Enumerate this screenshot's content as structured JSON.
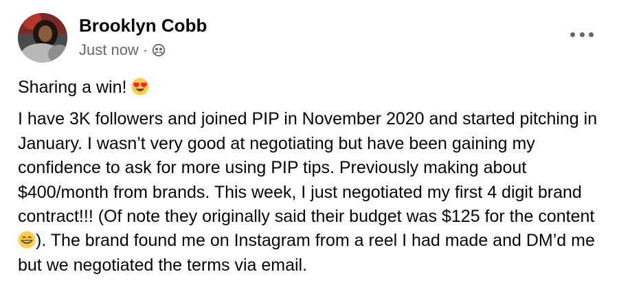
{
  "author": {
    "name": "Brooklyn Cobb",
    "timestamp": "Just now",
    "separator": "·",
    "privacy_icon": "friends-icon"
  },
  "menu": {
    "more_icon": "more-horizontal-icon"
  },
  "post": {
    "headline": "Sharing a win!",
    "headline_emoji": "heart-eyes-emoji",
    "body_part1": "I have 3K followers and joined PIP in November 2020 and started pitching in January. I wasn’t very good at negotiating but have been gaining my confidence to ask for more using PIP tips. Previously making about $400/month from brands. This week, I just negotiated my first 4 digit brand contract!!! (Of note they originally said their budget was $125 for the content",
    "inline_emoji": "grinning-teeth-emoji",
    "body_part2": "). The brand found me on Instagram from a reel I had made and DM’d me but we negotiated the terms via email."
  },
  "colors": {
    "text_primary": "#050505",
    "text_secondary": "#65676b",
    "emoji_yellow": "#ffcc4d",
    "heart_red": "#f4243a"
  }
}
